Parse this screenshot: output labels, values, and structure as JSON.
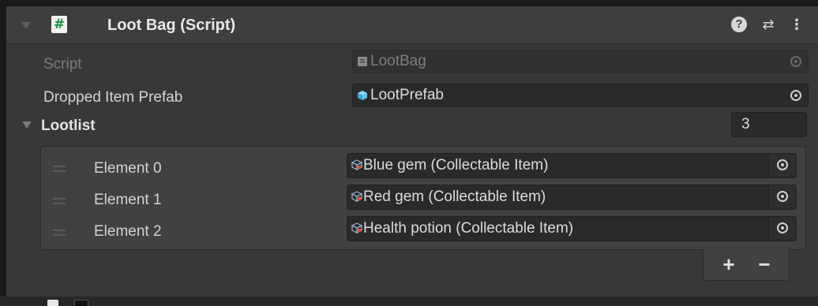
{
  "component": {
    "title": "Loot Bag (Script)",
    "script_badge": "#",
    "header_icons": {
      "help": "?",
      "preset": "⇄",
      "more": "⋮"
    }
  },
  "fields": {
    "script": {
      "label": "Script",
      "value": "LootBag",
      "icon": "script-asset-icon"
    },
    "dropped_item_prefab": {
      "label": "Dropped Item Prefab",
      "value": "LootPrefab",
      "icon": "prefab-cube-icon"
    }
  },
  "lootlist": {
    "label": "Lootlist",
    "size": "3",
    "elements": [
      {
        "label": "Element 0",
        "value": "Blue gem (Collectable Item)"
      },
      {
        "label": "Element 1",
        "value": "Red gem (Collectable Item)"
      },
      {
        "label": "Element 2",
        "value": "Health potion (Collectable Item)"
      }
    ],
    "add_label": "+",
    "remove_label": "−"
  },
  "colors": {
    "panel": "#383838",
    "header": "#3e3e3e",
    "field": "#2a2a2a",
    "prefab_blue": "#5cc4f0",
    "script_green": "#1c8a3a"
  }
}
